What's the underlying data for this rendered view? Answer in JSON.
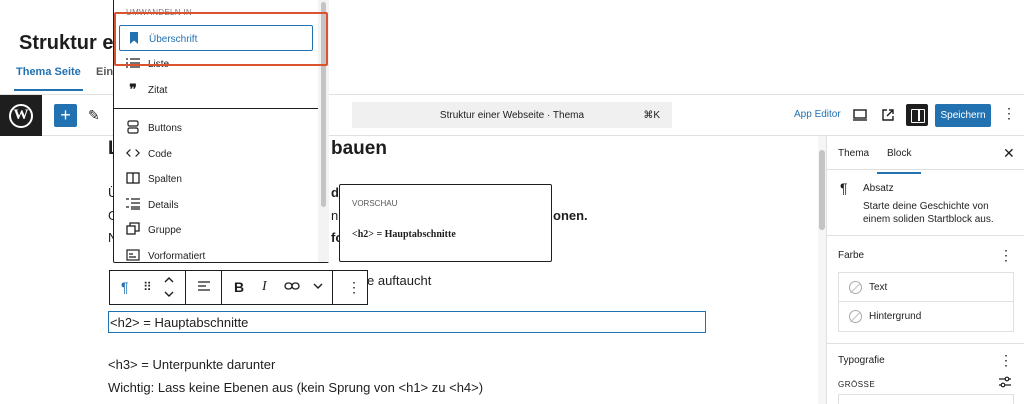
{
  "page_header": {
    "title": "Struktur ein",
    "tabs": [
      {
        "label": "Thema Seite",
        "active": true
      },
      {
        "label": "Eins",
        "active": false
      }
    ]
  },
  "topbar": {
    "command_bar_text": "Struktur einer Webseite · Thema",
    "command_bar_shortcut": "⌘K",
    "app_editor_label": "App Editor",
    "save_label": "Speichern",
    "icons": [
      "wordpress-logo",
      "plus-icon",
      "pencil-icon",
      "desktop-preview-icon",
      "external-link-icon",
      "sidebar-toggle-icon",
      "more-vertical-icon"
    ]
  },
  "editor": {
    "heading_visible": "L",
    "heading_tail": "bauen",
    "lines": [
      {
        "pre": "Ü",
        "post": "de"
      },
      {
        "pre": "G",
        "post": "n",
        "tail": "onen."
      },
      {
        "pre": "N",
        "post": "fol"
      },
      {
        "pre": "",
        "post": "e auftaucht"
      }
    ],
    "selected_block": "<h2> = Hauptabschnitte",
    "para_h3": "<h3> = Unterpunkte darunter",
    "para_wichtig": "Wichtig: Lass keine Ebenen aus (kein Sprung von <h1> zu <h4>)"
  },
  "block_toolbar": {
    "items": [
      "paragraph-icon",
      "drag-handle-icon",
      "move-up-down-icon",
      "align-icon",
      "bold-icon",
      "italic-icon",
      "link-icon",
      "chevron-down-icon",
      "more-vertical-icon"
    ],
    "bold_glyph": "B",
    "italic_glyph": "I"
  },
  "transform_menu": {
    "title": "UMWANDELN IN",
    "items": [
      {
        "label": "Überschrift",
        "icon": "bookmark-icon",
        "selected": true
      },
      {
        "label": "Liste",
        "icon": "list-icon"
      },
      {
        "label": "Zitat",
        "icon": "quote-icon"
      },
      {
        "label": "Buttons",
        "icon": "buttons-icon"
      },
      {
        "label": "Code",
        "icon": "code-icon"
      },
      {
        "label": "Spalten",
        "icon": "columns-icon"
      },
      {
        "label": "Details",
        "icon": "details-icon"
      },
      {
        "label": "Gruppe",
        "icon": "group-icon"
      },
      {
        "label": "Vorformatiert",
        "icon": "preformatted-icon"
      }
    ]
  },
  "preview": {
    "label": "VORSCHAU",
    "sample": "<h2> = Hauptabschnitte"
  },
  "sidebar": {
    "tabs": [
      "Thema",
      "Block"
    ],
    "active_tab": "Block",
    "block_name": "Absatz",
    "block_description": "Starte deine Geschichte von einem soliden Startblock aus.",
    "color_section": "Farbe",
    "colors": [
      "Text",
      "Hintergrund"
    ],
    "typography_section": "Typografie",
    "size_label": "GRÖSSE"
  },
  "colors": {
    "accent": "#2271b1",
    "highlight": "#d9532f",
    "dark": "#1e1e1e"
  }
}
